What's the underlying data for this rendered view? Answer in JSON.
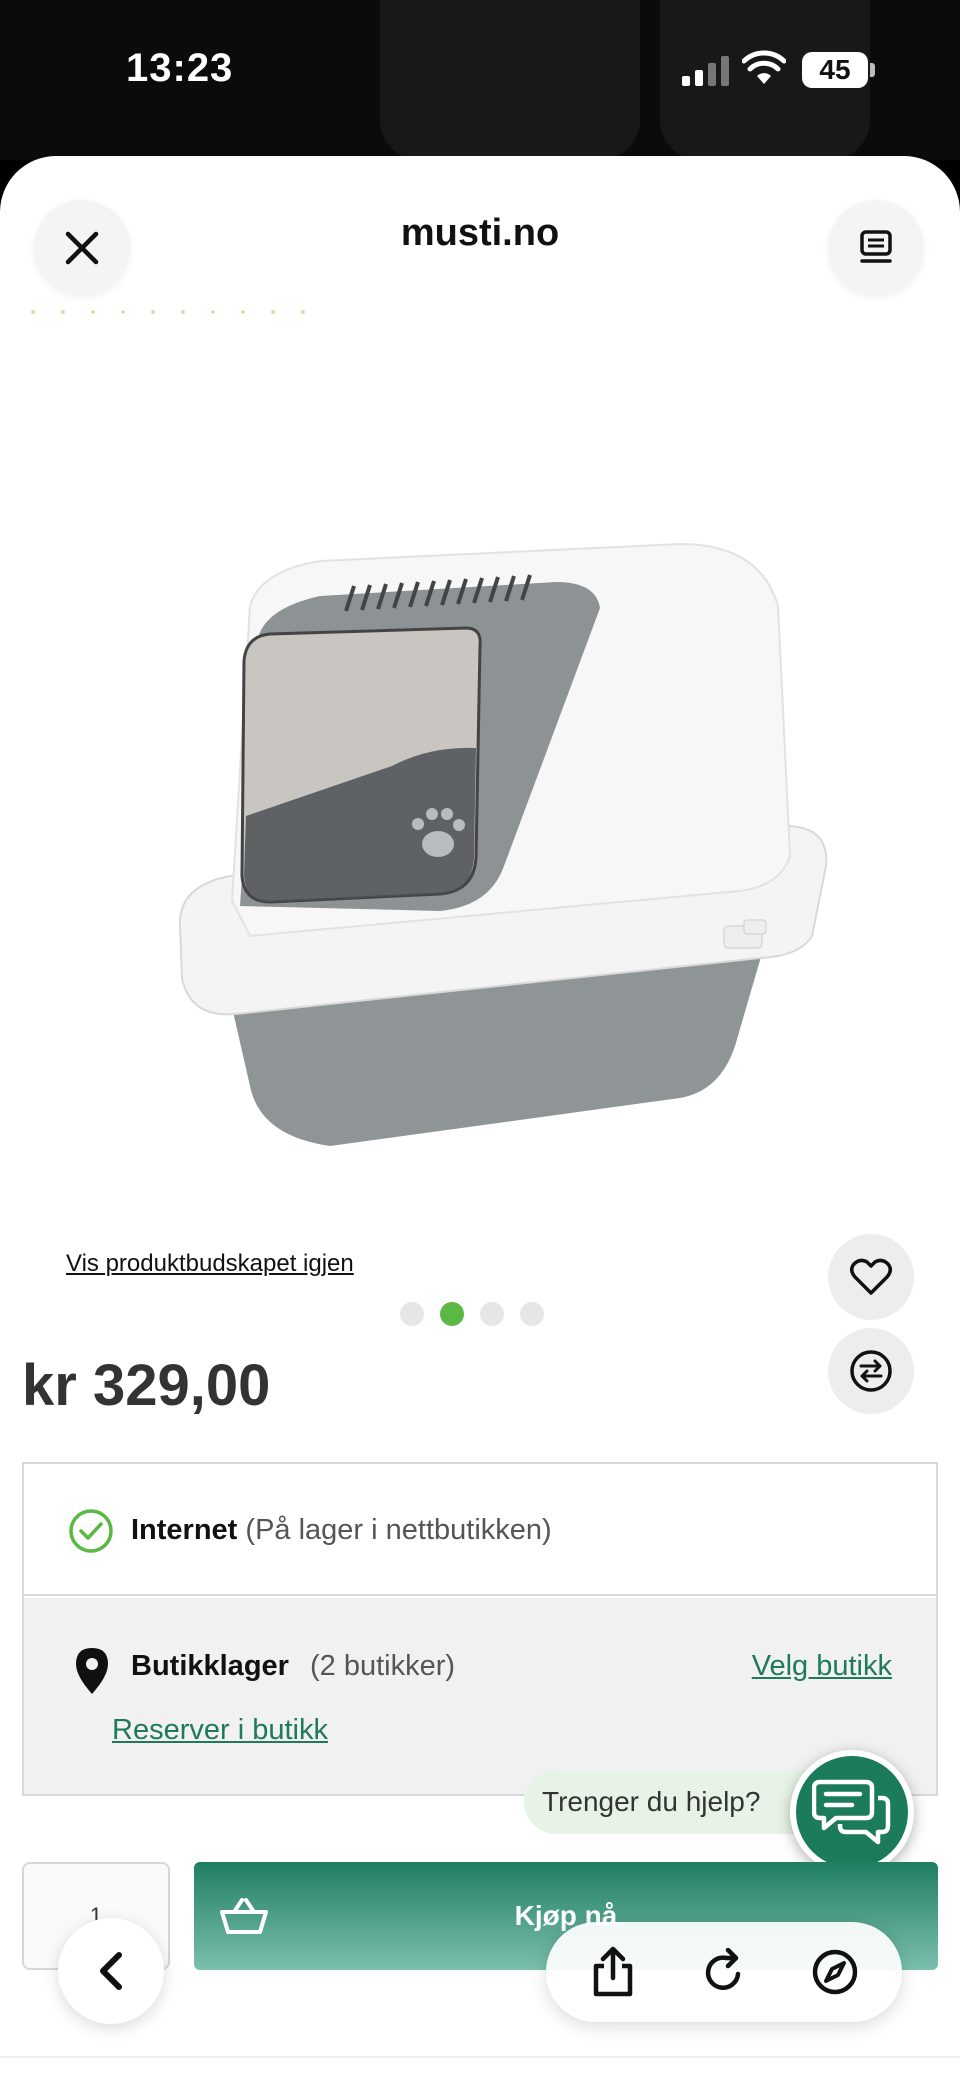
{
  "status": {
    "time": "13:23",
    "battery": "45"
  },
  "browser": {
    "domain": "musti.no"
  },
  "product": {
    "message_link": "Vis produktbudskapet igjen",
    "carousel": {
      "count": 4,
      "active_index": 2
    },
    "price": "kr 329,00"
  },
  "stock": {
    "online_label": "Internet",
    "online_detail": "(På lager i nettbutikken)",
    "store_label": "Butikklager",
    "store_count": "(2 butikker)",
    "choose_store": "Velg butikk",
    "reserve": "Reserver i butikk"
  },
  "help": {
    "text": "Trenger du hjelp?"
  },
  "cart": {
    "quantity": "1",
    "buy_label": "Kjøp nå"
  },
  "colors": {
    "accent": "#1f7a5c",
    "dot_active": "#5ab843"
  }
}
